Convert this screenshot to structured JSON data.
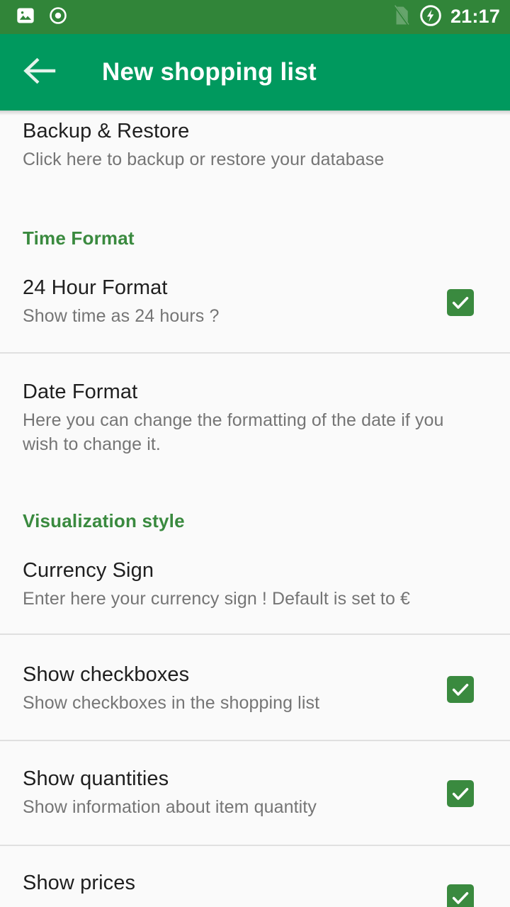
{
  "status_bar": {
    "icons_left": [
      "image-icon",
      "record-circle-icon"
    ],
    "icons_right": [
      "sim-card-off-icon",
      "battery-charging-icon"
    ],
    "time": "21:17",
    "background_color": "#318539"
  },
  "app_bar": {
    "back_icon": "back-arrow-icon",
    "title": "New shopping list",
    "background_color": "#00995e"
  },
  "theme": {
    "accent_green": "#3a8a3f",
    "page_background": "#fafafa",
    "title_color": "#1f1f1f",
    "summary_color": "#757575",
    "divider_color": "#e0e0e0"
  },
  "preferences": [
    {
      "name": "backup-restore",
      "title": "Backup & Restore",
      "summary": "Click here to backup or restore your database",
      "has_checkbox": false
    },
    {
      "name": "24-hour-format",
      "title": "24 Hour Format",
      "summary": "Show time as 24 hours ?",
      "has_checkbox": true,
      "checked": true
    },
    {
      "name": "date-format",
      "title": "Date Format",
      "summary": "Here you can change the formatting of the date if you wish to change it.",
      "has_checkbox": false
    },
    {
      "name": "currency-sign",
      "title": "Currency Sign",
      "summary": "Enter here your currency sign ! Default is set to €",
      "has_checkbox": false
    },
    {
      "name": "show-checkboxes",
      "title": "Show checkboxes",
      "summary": "Show checkboxes in the shopping list",
      "has_checkbox": true,
      "checked": true
    },
    {
      "name": "show-quantities",
      "title": "Show quantities",
      "summary": "Show information about item quantity",
      "has_checkbox": true,
      "checked": true
    },
    {
      "name": "show-prices",
      "title": "Show prices",
      "summary": "",
      "has_checkbox": true,
      "checked": true
    }
  ],
  "sections": {
    "time_format": "Time Format",
    "visualization_style": "Visualization style"
  }
}
